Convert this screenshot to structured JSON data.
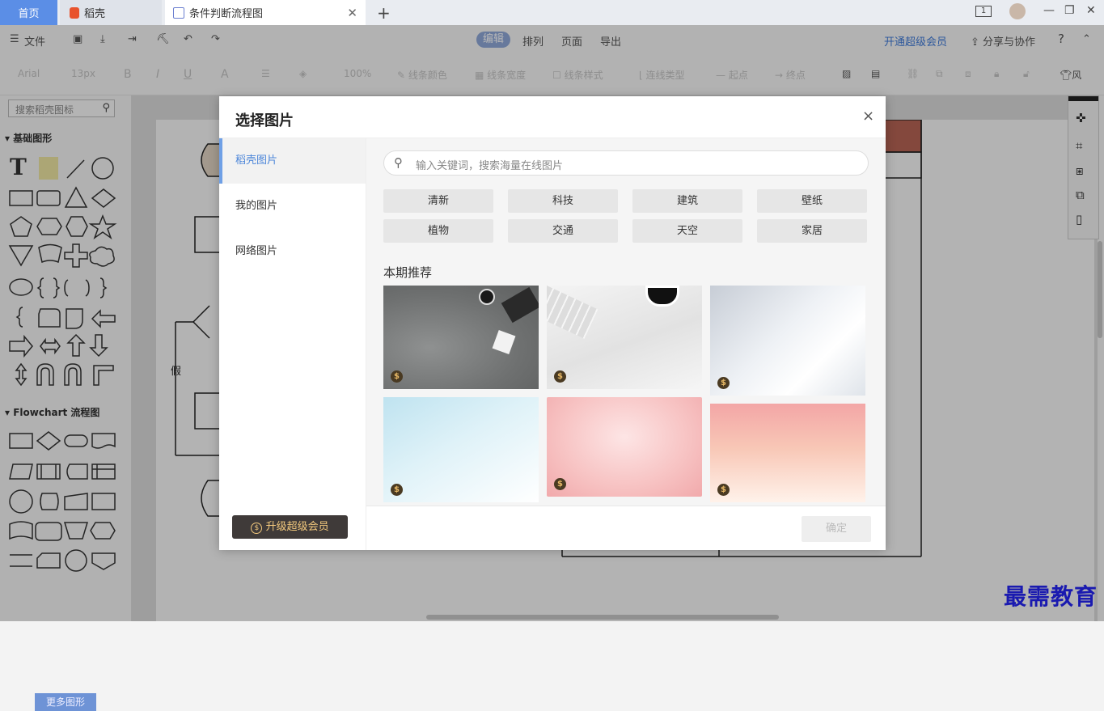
{
  "tabs": {
    "home": "首页",
    "daoke": "稻壳",
    "flow": "条件判断流程图",
    "add": "+"
  },
  "window": {
    "page_indicator": "1",
    "minimize": "—",
    "restore": "❐",
    "close": "✕"
  },
  "menubar": {
    "file": "文件",
    "modes": [
      "编辑",
      "排列",
      "页面",
      "导出"
    ],
    "vip": "开通超级会员",
    "share": "分享与协作",
    "help": "?"
  },
  "toolbar": {
    "font": "Arial",
    "size": "13px",
    "bold": "B",
    "italic": "I",
    "underline": "U",
    "font_color": "A",
    "zoom": "100%",
    "line_color": "线条颜色",
    "line_width": "线条宽度",
    "line_style": "线条样式",
    "connector_type": "连线类型",
    "start_point": "起点",
    "end_point": "终点",
    "more": "风"
  },
  "left_panel": {
    "search_placeholder": "搜索稻壳图标",
    "basic_shapes": "基础图形",
    "flowchart": "Flowchart 流程图",
    "more_shapes": "更多图形"
  },
  "canvas": {
    "false_label": "假"
  },
  "dialog": {
    "title": "选择图片",
    "close": "×",
    "nav": [
      "稻壳图片",
      "我的图片",
      "网络图片"
    ],
    "upgrade": "升级超级会员",
    "search_placeholder": "输入关键词，搜索海量在线图片",
    "categories": [
      "清新",
      "科技",
      "建筑",
      "壁纸",
      "植物",
      "交通",
      "天空",
      "家居"
    ],
    "recommend_title": "本期推荐",
    "confirm": "确定",
    "coin_symbol": "$",
    "accent_color": "#4c86d9"
  },
  "watermark": "最需教育"
}
